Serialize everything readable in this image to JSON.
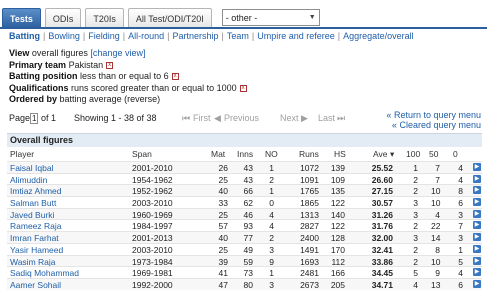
{
  "tabs": [
    "Tests",
    "ODIs",
    "T20Is",
    "All Test/ODI/T20I"
  ],
  "other_select": "- other -",
  "subnav": [
    "Batting",
    "Bowling",
    "Fielding",
    "All-round",
    "Partnership",
    "Team",
    "Umpire and referee",
    "Aggregate/overall"
  ],
  "criteria": {
    "view_label": "View",
    "view_value": "overall figures",
    "change_view": "[change view]",
    "primary_label": "Primary team",
    "primary_value": "Pakistan",
    "position_label": "Batting position",
    "position_value": "less than or equal to 6",
    "qual_label": "Qualifications",
    "qual_value": "runs scored greater than or equal to 1000",
    "order_label": "Ordered by",
    "order_value": "batting average (reverse)"
  },
  "pager": {
    "page_text": "Page",
    "page_num": "1",
    "of_text": "of 1",
    "showing": "Showing 1 - 38 of 38",
    "first": "First",
    "previous": "Previous",
    "next": "Next",
    "last": "Last"
  },
  "links": {
    "return": "Return to query menu",
    "cleared": "Cleared query menu"
  },
  "table_title": "Overall figures",
  "columns": [
    "Player",
    "Span",
    "Mat",
    "Inns",
    "NO",
    "Runs",
    "HS",
    "Ave",
    "100",
    "50",
    "0"
  ],
  "rows": [
    {
      "player": "Faisal Iqbal",
      "span": "2001-2010",
      "mat": "26",
      "inns": "43",
      "no": "1",
      "runs": "1072",
      "hs": "139",
      "ave": "25.52",
      "h": "1",
      "f": "7",
      "z": "4"
    },
    {
      "player": "Alimuddin",
      "span": "1954-1962",
      "mat": "25",
      "inns": "43",
      "no": "2",
      "runs": "1091",
      "hs": "109",
      "ave": "26.60",
      "h": "2",
      "f": "7",
      "z": "4"
    },
    {
      "player": "Imtiaz Ahmed",
      "span": "1952-1962",
      "mat": "40",
      "inns": "66",
      "no": "1",
      "runs": "1765",
      "hs": "135",
      "ave": "27.15",
      "h": "2",
      "f": "10",
      "z": "8"
    },
    {
      "player": "Salman Butt",
      "span": "2003-2010",
      "mat": "33",
      "inns": "62",
      "no": "0",
      "runs": "1865",
      "hs": "122",
      "ave": "30.57",
      "h": "3",
      "f": "10",
      "z": "6"
    },
    {
      "player": "Javed Burki",
      "span": "1960-1969",
      "mat": "25",
      "inns": "46",
      "no": "4",
      "runs": "1313",
      "hs": "140",
      "ave": "31.26",
      "h": "3",
      "f": "4",
      "z": "3"
    },
    {
      "player": "Rameez Raja",
      "span": "1984-1997",
      "mat": "57",
      "inns": "93",
      "no": "4",
      "runs": "2827",
      "hs": "122",
      "ave": "31.76",
      "h": "2",
      "f": "22",
      "z": "7"
    },
    {
      "player": "Imran Farhat",
      "span": "2001-2013",
      "mat": "40",
      "inns": "77",
      "no": "2",
      "runs": "2400",
      "hs": "128",
      "ave": "32.00",
      "h": "3",
      "f": "14",
      "z": "3"
    },
    {
      "player": "Yasir Hameed",
      "span": "2003-2010",
      "mat": "25",
      "inns": "49",
      "no": "3",
      "runs": "1491",
      "hs": "170",
      "ave": "32.41",
      "h": "2",
      "f": "8",
      "z": "1"
    },
    {
      "player": "Wasim Raja",
      "span": "1973-1984",
      "mat": "39",
      "inns": "59",
      "no": "9",
      "runs": "1693",
      "hs": "112",
      "ave": "33.86",
      "h": "2",
      "f": "10",
      "z": "5"
    },
    {
      "player": "Sadiq Mohammad",
      "span": "1969-1981",
      "mat": "41",
      "inns": "73",
      "no": "1",
      "runs": "2481",
      "hs": "166",
      "ave": "34.45",
      "h": "5",
      "f": "9",
      "z": "4"
    },
    {
      "player": "Aamer Sohail",
      "span": "1992-2000",
      "mat": "47",
      "inns": "80",
      "no": "3",
      "runs": "2673",
      "hs": "205",
      "ave": "34.71",
      "h": "4",
      "f": "13",
      "z": "6"
    }
  ]
}
